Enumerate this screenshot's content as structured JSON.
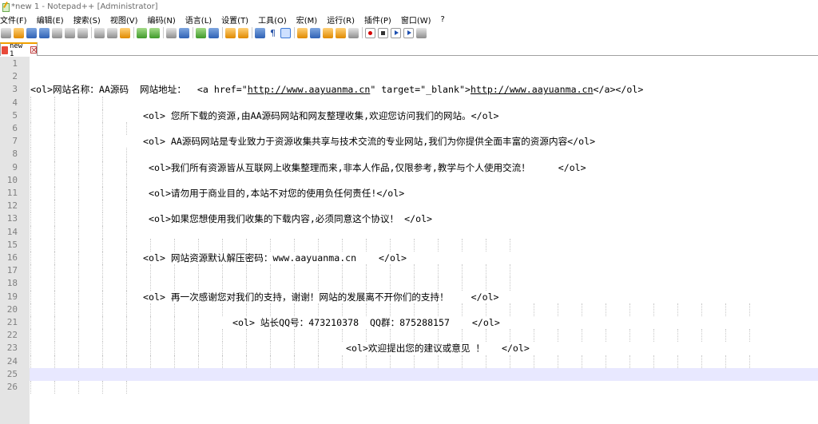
{
  "window": {
    "title": "*new 1 - Notepad++ [Administrator]"
  },
  "menu": [
    "文件(F)",
    "编辑(E)",
    "搜索(S)",
    "视图(V)",
    "编码(N)",
    "语言(L)",
    "设置(T)",
    "工具(O)",
    "宏(M)",
    "运行(R)",
    "插件(P)",
    "窗口(W)",
    "?"
  ],
  "toolbar": {
    "icons": [
      "new-file-icon",
      "open-file-icon",
      "save-icon",
      "save-all-icon",
      "close-icon",
      "close-all-icon",
      "print-icon",
      "cut-icon",
      "copy-icon",
      "paste-icon",
      "undo-icon",
      "redo-icon",
      "find-icon",
      "replace-icon",
      "zoom-in-icon",
      "zoom-out-icon",
      "sync-vertical-icon",
      "sync-horizontal-icon",
      "word-wrap-icon",
      "show-all-chars-icon",
      "indent-guide-icon",
      "user-lang-icon",
      "doc-map-icon",
      "function-list-icon",
      "folder-workspace-icon",
      "monitoring-icon",
      "record-macro-icon",
      "stop-macro-icon",
      "play-macro-icon",
      "run-macro-multiple-icon",
      "save-macro-icon"
    ]
  },
  "tab": {
    "label": "new 1"
  },
  "editor": {
    "line_numbers": [
      "1",
      "2",
      "3",
      "4",
      "5",
      "6",
      "7",
      "8",
      "9",
      "10",
      "11",
      "12",
      "13",
      "14",
      "15",
      "16",
      "17",
      "18",
      "19",
      "20",
      "21",
      "22",
      "23",
      "24",
      "25",
      "26"
    ],
    "current_line": 25,
    "lines": [
      {
        "n": 3,
        "parts": [
          {
            "t": "<ol>网站名称：AA源码  网站地址：  <a href=\""
          },
          {
            "t": "http://www.aayuanma.cn",
            "u": true
          },
          {
            "t": "\" target=\"_blank\">"
          },
          {
            "t": "http://www.aayuanma.cn",
            "u": true
          },
          {
            "t": "</a></ol>"
          }
        ]
      },
      {
        "n": 5,
        "parts": [
          {
            "t": "<ol> 您所下载的资源,由AA源码网站和网友整理收集,欢迎您访问我们的网站。</ol>"
          }
        ]
      },
      {
        "n": 7,
        "parts": [
          {
            "t": "<ol> AA源码网站是专业致力于资源收集共享与技术交流的专业网站,我们为你提供全面丰富的资源内容</ol>"
          }
        ]
      },
      {
        "n": 9,
        "parts": [
          {
            "t": "<ol>我们所有资源皆从互联网上收集整理而来,非本人作品,仅限参考,教学与个人使用交流！     </ol>"
          }
        ]
      },
      {
        "n": 11,
        "parts": [
          {
            "t": "<ol>请勿用于商业目的,本站不对您的使用负任何责任!</ol>"
          }
        ]
      },
      {
        "n": 13,
        "parts": [
          {
            "t": "<ol>如果您想使用我们收集的下载内容,必须同意这个协议！ </ol>"
          }
        ]
      },
      {
        "n": 16,
        "parts": [
          {
            "t": "<ol> 网站资源默认解压密码：www.aayuanma.cn    </ol>"
          }
        ]
      },
      {
        "n": 19,
        "parts": [
          {
            "t": "<ol> 再一次感谢您对我们的支持，谢谢！网站的发展离不开你们的支持！    </ol>"
          }
        ]
      },
      {
        "n": 21,
        "parts": [
          {
            "t": "<ol> 站长QQ号：473210378  QQ群：875288157    </ol>"
          }
        ]
      },
      {
        "n": 23,
        "parts": [
          {
            "t": "<ol>欢迎提出您的建议或意见 ！   </ol>"
          }
        ]
      }
    ]
  }
}
